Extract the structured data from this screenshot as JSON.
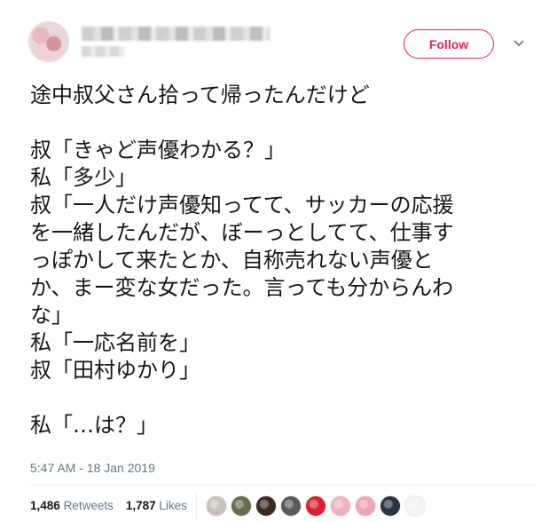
{
  "header": {
    "follow_label": "Follow"
  },
  "tweet": {
    "lines": [
      "途中叔父さん拾って帰ったんだけど",
      "",
      "叔「きゃど声優わかる？」",
      "私「多少」",
      "叔「一人だけ声優知ってて、サッカーの応援",
      "を一緒したんだが、ぼーっとしてて、仕事す",
      "っぽかして来たとか、自称売れない声優と",
      "か、まー変な女だった。言っても分からんわ",
      "な」",
      "私「一応名前を」",
      "叔「田村ゆかり」",
      "",
      "私「…は？」"
    ],
    "timestamp": "5:47 AM - 18 Jan 2019"
  },
  "stats": {
    "retweets_count": "1,486",
    "retweets_label": "Retweets",
    "likes_count": "1,787",
    "likes_label": "Likes"
  },
  "likers": [
    {
      "icon": "avatar-1-icon",
      "color": "#c9c2b8"
    },
    {
      "icon": "avatar-2-icon",
      "color": "#6b6b4e"
    },
    {
      "icon": "avatar-3-icon",
      "color": "#3a2a1e"
    },
    {
      "icon": "avatar-4-icon",
      "color": "#5a5a5a"
    },
    {
      "icon": "avatar-5-icon",
      "color": "#d8202f"
    },
    {
      "icon": "avatar-6-icon",
      "color": "#f1b2c0"
    },
    {
      "icon": "avatar-7-icon",
      "color": "#f4a3b5"
    },
    {
      "icon": "avatar-8-icon",
      "color": "#2a3340"
    },
    {
      "icon": "avatar-9-icon",
      "color": "#f5f5f5"
    }
  ],
  "colors": {
    "accent": "#e0245e",
    "text": "#14171a",
    "muted": "#657786",
    "divider": "#e6ecf0"
  }
}
